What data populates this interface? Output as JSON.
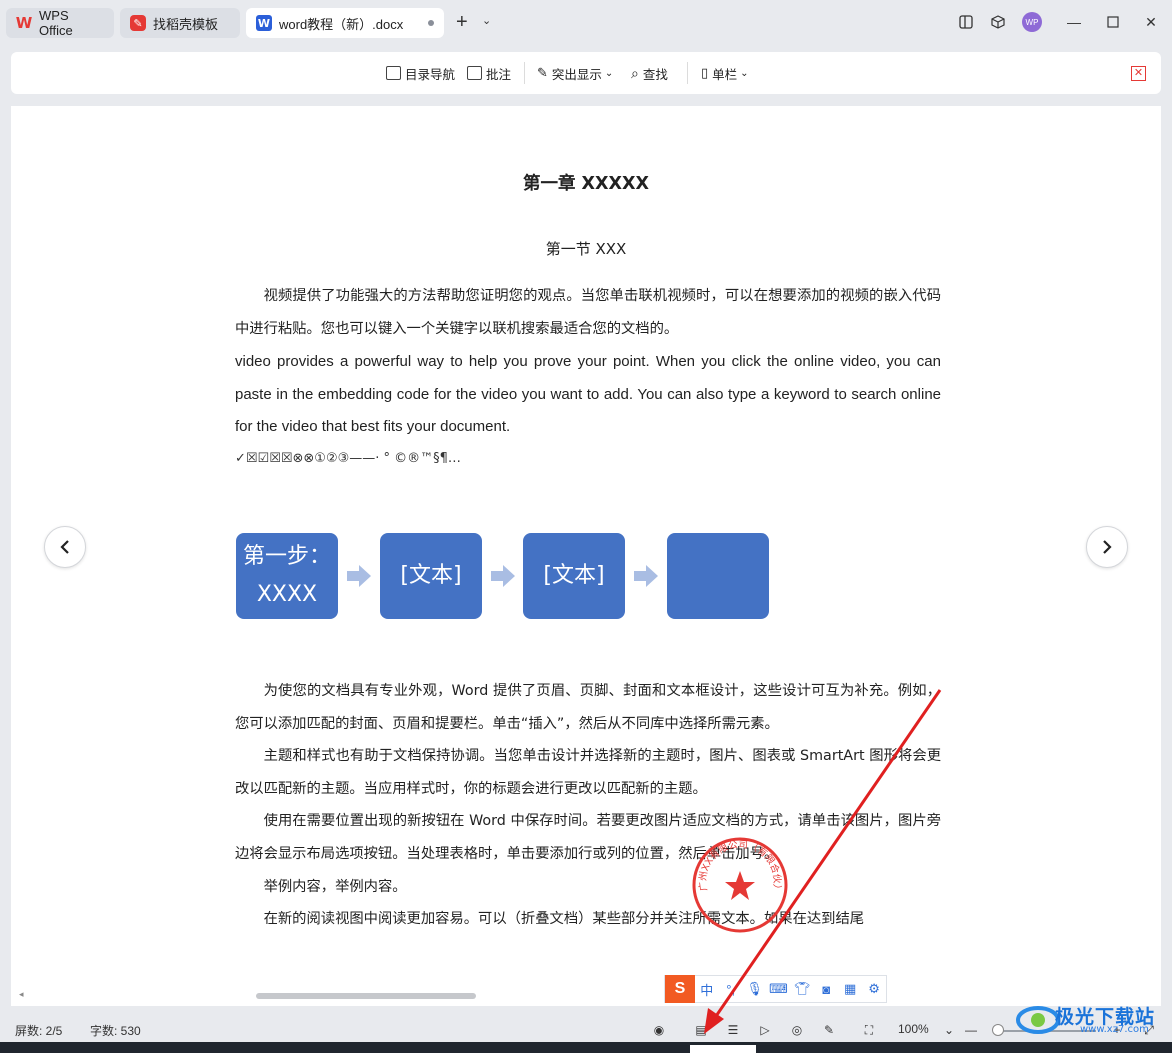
{
  "tabs": [
    {
      "label": "WPS Office"
    },
    {
      "label": "找稻壳模板"
    },
    {
      "label": "word教程（新）.docx"
    }
  ],
  "window": {
    "avatar_text": "WP"
  },
  "toolbar": {
    "toc_label": "目录导航",
    "comment_label": "批注",
    "highlight_label": "突出显示",
    "find_label": "查找",
    "column_label": "单栏"
  },
  "document": {
    "chapter_title": "第一章  XXXXX",
    "section_title": "第一节  XXX",
    "p1": "视频提供了功能强大的方法帮助您证明您的观点。当您单击联机视频时，可以在想要添加的视频的嵌入代码中进行粘贴。您也可以键入一个关键字以联机搜索最适合您的文档的。",
    "p2": "video provides a powerful way to help you prove your point. When you click the online video, you can paste in the embedding code for the video you want to add. You can also type a keyword to search online for the video that best fits your document.",
    "p3": "✓☒☑☒☒⊗⊗①②③——·    °   ©®™§¶…",
    "smartart": [
      "第一步：XXXX",
      "[文本]",
      "[文本]",
      ""
    ],
    "p4": "为使您的文档具有专业外观，Word 提供了页眉、页脚、封面和文本框设计，这些设计可互为补充。例如，您可以添加匹配的封面、页眉和提要栏。单击“插入”，然后从不同库中选择所需元素。",
    "p5": "主题和样式也有助于文档保持协调。当您单击设计并选择新的主题时，图片、图表或 SmartArt 图形将会更改以匹配新的主题。当应用样式时，你的标题会进行更改以匹配新的主题。",
    "p6": "使用在需要位置出现的新按钮在 Word 中保存时间。若要更改图片适应文档的方式，请单击该图片，图片旁边将会显示布局选项按钮。当处理表格时，单击要添加行或列的位置，然后单击加号。",
    "p7": "举例内容，举例内容。",
    "p8": "在新的阅读视图中阅读更加容易。可以（折叠文档）某些部分并关注所需文本。如果在达到结尾",
    "stamp_text": "广州XX有限公司（有限合伙）"
  },
  "ime": {
    "logo": "S",
    "mode": "中"
  },
  "status": {
    "page": "屏数: 2/5",
    "words": "字数: 530",
    "zoom": "100%"
  },
  "watermark": {
    "text": "极光下载站",
    "url": "www.xz7.com"
  },
  "colors": {
    "accent": "#4472c4",
    "arrow": "#e02020",
    "stamp": "#e53935"
  }
}
